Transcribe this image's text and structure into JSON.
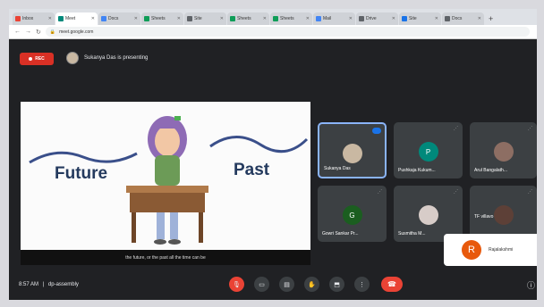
{
  "browser": {
    "tabs": [
      {
        "label": "Inbox",
        "color": "#ea4335"
      },
      {
        "label": "Meet",
        "color": "#00897b",
        "active": true
      },
      {
        "label": "Docs",
        "color": "#4285f4"
      },
      {
        "label": "Sheets",
        "color": "#0f9d58"
      },
      {
        "label": "Site",
        "color": "#5f6368"
      },
      {
        "label": "Sheets",
        "color": "#0f9d58"
      },
      {
        "label": "Sheets",
        "color": "#0f9d58"
      },
      {
        "label": "Mail",
        "color": "#4285f4"
      },
      {
        "label": "Drive",
        "color": "#5f6368"
      },
      {
        "label": "Site",
        "color": "#1a73e8"
      },
      {
        "label": "Docs",
        "color": "#5f6368"
      }
    ],
    "url": "meet.google.com"
  },
  "meeting": {
    "rec_label": "REC",
    "presenter_text": "Sukanya Das is presenting",
    "caption": "the future, or the past all the time can be",
    "time": "8:57 AM",
    "separator": "|",
    "meeting_code": "dp-assembly"
  },
  "slide": {
    "left_word": "Future",
    "right_word": "Past"
  },
  "participants": [
    {
      "name": "Sukanya Das",
      "initial": "",
      "color": "#c9b8a2",
      "speaking": true
    },
    {
      "name": "Pushkaja Kukum...",
      "initial": "P",
      "color": "#00897b"
    },
    {
      "name": "Arul Bangalath...",
      "initial": "",
      "color": "#8d6e63"
    },
    {
      "name": "Gowri Sankar Pr...",
      "initial": "G",
      "color": "#1b5e20"
    },
    {
      "name": "Susmitha M...",
      "initial": "",
      "color": "#d7ccc8"
    },
    {
      "name": "TF villavo",
      "initial": "",
      "color": "#5d4037"
    }
  ],
  "popup": {
    "initial": "R",
    "name": "Rajalakshmi"
  },
  "colors": {
    "end_call": "#ea4335",
    "rec": "#d93025",
    "active_tile": "#8ab4f8"
  }
}
